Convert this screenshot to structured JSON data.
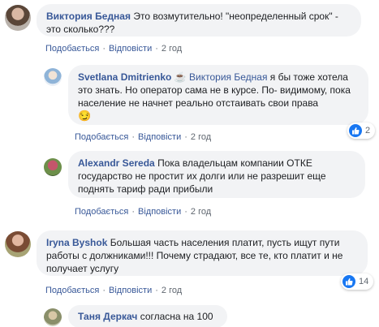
{
  "actions": {
    "like": "Подобається",
    "reply": "Відповісти",
    "sep": "·"
  },
  "colors": {
    "link": "#385898",
    "bubble": "#f2f3f5",
    "like": "#1877f2"
  },
  "comments": [
    {
      "author": "Виктория Бедная",
      "text": "Это возмутительно! \"неопределенный срок\" - это сколько???",
      "time": "2 год",
      "avatar_icon": "user-photo"
    },
    {
      "author": "Svetlana Dmitrienko",
      "author_badge": "☕",
      "mention": "Виктория Бедная",
      "text": " я бы тоже хотела это знать. Но оператор сама не в курсе. По- видимому, пока население не начнет реально отстаивать свои права",
      "emoji": "😏",
      "time": "2 год",
      "reactions": "2"
    },
    {
      "author": "Alexandr Sereda",
      "text": "Пока владельцам компании ОТКЕ государство не простит их долги или не разрешит еще поднять тариф ради прибыли",
      "time": "2 год"
    },
    {
      "author": "Iryna Byshok",
      "text": "Большая часть населения платит, пусть ищут пути работы с должниками!!! Почему страдают, все те, кто платит и не получает услугу",
      "time": "2 год",
      "reactions": "14"
    },
    {
      "author": "Таня Деркач",
      "text": "согласна на 100"
    }
  ]
}
